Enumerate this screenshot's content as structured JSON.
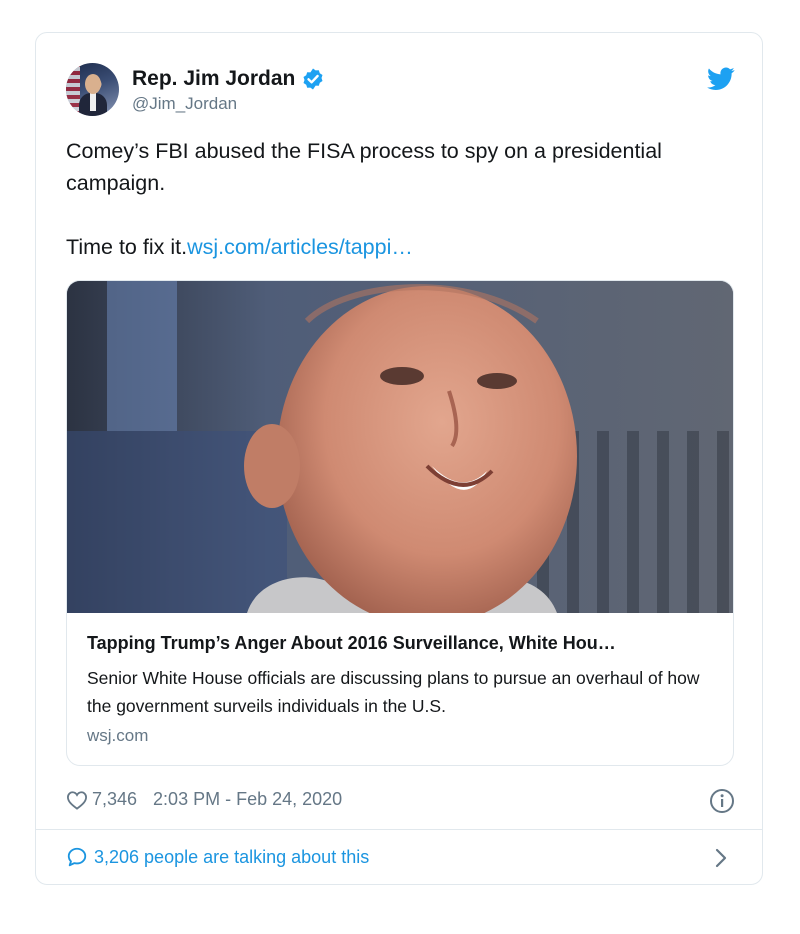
{
  "author": {
    "name": "Rep. Jim Jordan",
    "handle": "@Jim_Jordan",
    "verified": true
  },
  "tweet": {
    "line1": "Comey’s FBI abused the FISA process to spy on a presidential campaign.",
    "line2_text": "Time to fix it.",
    "line2_link": "wsj.com/articles/tappi…"
  },
  "link_preview": {
    "title": "Tapping Trump’s Anger About 2016 Surveillance, White Hou…",
    "description": "Senior White House officials are discussing plans to pursue an overhaul of how the government surveils individuals in the U.S.",
    "domain": "wsj.com"
  },
  "footer": {
    "likes": "7,346",
    "timestamp": "2:03 PM - Feb 24, 2020",
    "talking": "3,206 people are talking about this"
  },
  "icons": {
    "verified": "verified-badge-icon",
    "brand": "twitter-bird-icon",
    "like": "heart-icon",
    "info": "info-icon",
    "reply": "speech-bubble-icon",
    "more": "chevron-right-icon"
  },
  "colors": {
    "accent": "#1b95e0",
    "text": "#14171a",
    "muted": "#657786",
    "border": "#e1e8ed"
  }
}
